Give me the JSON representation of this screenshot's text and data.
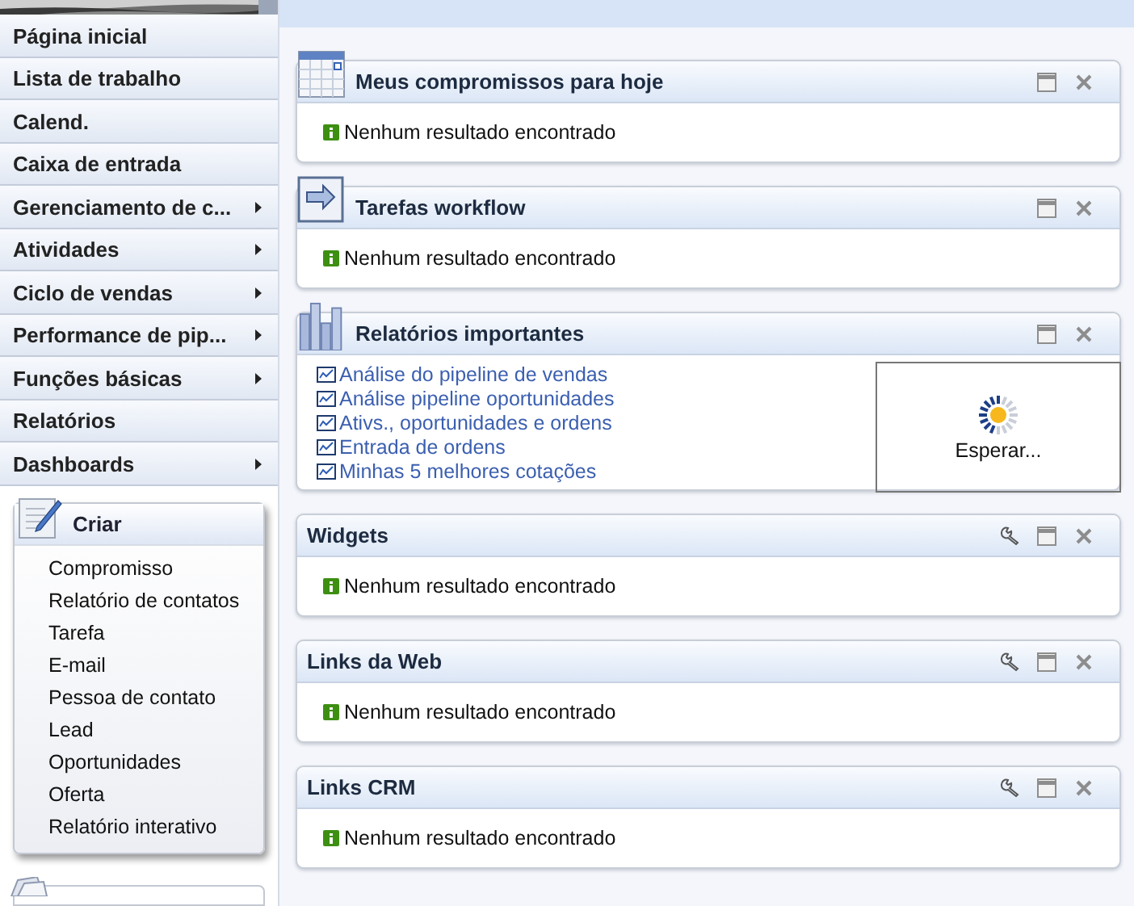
{
  "sidebar": {
    "menu": [
      {
        "label": "Página inicial",
        "submenu": false
      },
      {
        "label": "Lista de trabalho",
        "submenu": false
      },
      {
        "label": "Calend.",
        "submenu": false
      },
      {
        "label": "Caixa de entrada",
        "submenu": false
      },
      {
        "label": "Gerenciamento de c...",
        "submenu": true
      },
      {
        "label": "Atividades",
        "submenu": true
      },
      {
        "label": "Ciclo de vendas",
        "submenu": true
      },
      {
        "label": "Performance de pip...",
        "submenu": true
      },
      {
        "label": "Funções básicas",
        "submenu": true
      },
      {
        "label": "Relatórios",
        "submenu": false
      },
      {
        "label": "Dashboards",
        "submenu": true
      }
    ],
    "create": {
      "title": "Criar",
      "items": [
        "Compromisso",
        "Relatório de contatos",
        "Tarefa",
        "E-mail",
        "Pessoa de contato",
        "Lead",
        "Oportunidades",
        "Oferta",
        "Relatório interativo"
      ]
    }
  },
  "panels": [
    {
      "title": "Meus compromissos para hoje",
      "configurable": false,
      "kind": "appointments",
      "message": "Nenhum resultado encontrado"
    },
    {
      "title": "Tarefas workflow",
      "configurable": false,
      "kind": "workflow",
      "message": "Nenhum resultado encontrado"
    },
    {
      "title": "Relatórios importantes",
      "configurable": false,
      "kind": "reports",
      "links": [
        "Análise do pipeline de vendas",
        "Análise pipeline oportunidades",
        "Ativs., oportunidades e ordens",
        "Entrada de ordens",
        "Minhas 5 melhores cotações"
      ],
      "loading": "Esperar..."
    },
    {
      "title": "Widgets",
      "configurable": true,
      "kind": "widgets",
      "message": "Nenhum resultado encontrado"
    },
    {
      "title": "Links da Web",
      "configurable": true,
      "kind": "links",
      "message": "Nenhum resultado encontrado"
    },
    {
      "title": "Links CRM",
      "configurable": true,
      "kind": "links",
      "message": "Nenhum resultado encontrado"
    }
  ]
}
